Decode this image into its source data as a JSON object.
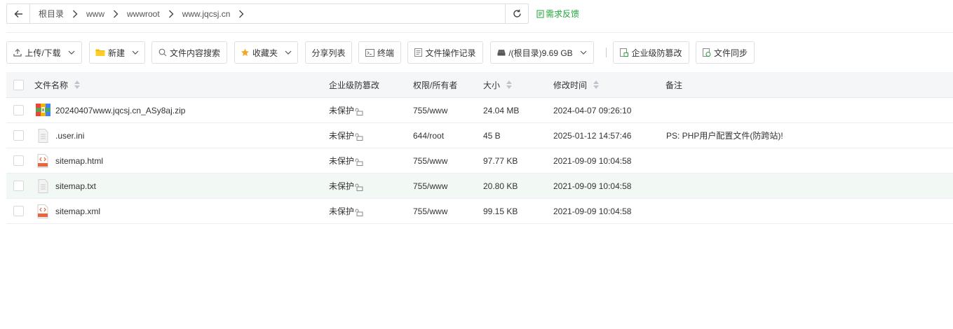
{
  "pathbar": {
    "back_icon": "arrow-left-icon",
    "crumbs": [
      "根目录",
      "www",
      "wwwroot",
      "www.jqcsj.cn"
    ],
    "refresh_icon": "refresh-icon"
  },
  "feedback": {
    "label": "需求反馈",
    "icon": "feedback-icon"
  },
  "toolbar": {
    "upload": "上传/下载",
    "new": "新建",
    "search": "文件内容搜索",
    "favorites": "收藏夹",
    "share": "分享列表",
    "terminal": "终端",
    "oplog": "文件操作记录",
    "disk": "/(根目录)9.69 GB",
    "tamper": "企业级防篡改",
    "sync": "文件同步"
  },
  "table": {
    "headers": {
      "name": "文件名称",
      "tamper": "企业级防篡改",
      "perm": "权限/所有者",
      "size": "大小",
      "mtime": "修改时间",
      "note": "备注"
    },
    "rows": [
      {
        "icon": "zip-file-icon",
        "name": "20240407www.jqcsj.cn_ASy8aj.zip",
        "tamper": "未保护",
        "perm": "755/www",
        "size": "24.04 MB",
        "mtime": "2024-04-07 09:26:10",
        "note": ""
      },
      {
        "icon": "ini-file-icon",
        "name": ".user.ini",
        "tamper": "未保护",
        "perm": "644/root",
        "size": "45 B",
        "mtime": "2025-01-12 14:57:46",
        "note": "PS: PHP用户配置文件(防跨站)!"
      },
      {
        "icon": "html-file-icon",
        "name": "sitemap.html",
        "tamper": "未保护",
        "perm": "755/www",
        "size": "97.77 KB",
        "mtime": "2021-09-09 10:04:58",
        "note": ""
      },
      {
        "icon": "txt-file-icon",
        "name": "sitemap.txt",
        "tamper": "未保护",
        "perm": "755/www",
        "size": "20.80 KB",
        "mtime": "2021-09-09 10:04:58",
        "note": ""
      },
      {
        "icon": "xml-file-icon",
        "name": "sitemap.xml",
        "tamper": "未保护",
        "perm": "755/www",
        "size": "99.15 KB",
        "mtime": "2021-09-09 10:04:58",
        "note": ""
      }
    ]
  },
  "colors": {
    "accent": "#20a53a",
    "header_bg": "#f5f6f7",
    "hover_row": "#f2f9f4"
  }
}
